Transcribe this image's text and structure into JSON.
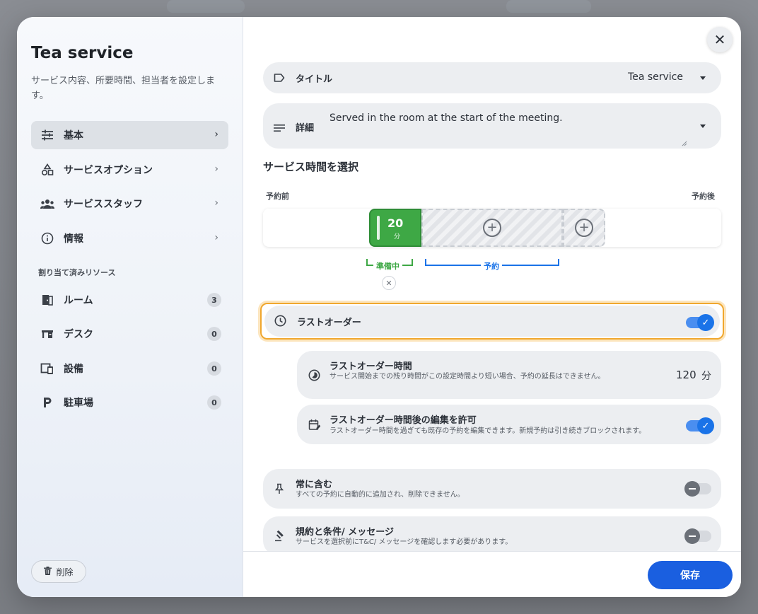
{
  "sidebar": {
    "title": "Tea service",
    "subtitle": "サービス内容、所要時間、担当者を設定します。",
    "nav": [
      {
        "label": "基本",
        "icon": "sliders-icon"
      },
      {
        "label": "サービスオプション",
        "icon": "shapes-icon"
      },
      {
        "label": "サービススタッフ",
        "icon": "group-icon"
      },
      {
        "label": "情報",
        "icon": "info-icon"
      }
    ],
    "resources_heading": "割り当て済みリソース",
    "resources": [
      {
        "label": "ルーム",
        "count": "3",
        "icon": "door-icon"
      },
      {
        "label": "デスク",
        "count": "0",
        "icon": "desk-icon"
      },
      {
        "label": "設備",
        "count": "0",
        "icon": "devices-icon"
      },
      {
        "label": "駐車場",
        "count": "0",
        "icon": "parking-icon"
      }
    ],
    "delete_label": "削除"
  },
  "main": {
    "close_glyph": "✕",
    "title_field": {
      "label": "タイトル",
      "value": "Tea service"
    },
    "detail_field": {
      "label": "詳細",
      "value": "Served in the room at the start of the meeting."
    },
    "service_time_heading": "サービス時間を選択",
    "timeline": {
      "before_label": "予約前",
      "after_label": "予約後",
      "prep_value": "20",
      "prep_unit": "分",
      "prep_bracket_label": "準備中",
      "booking_bracket_label": "予約",
      "remove_glyph": "✕",
      "add_glyph": "+"
    },
    "last_order": {
      "label": "ラストオーダー",
      "enabled": true
    },
    "last_order_time": {
      "title": "ラストオーダー時間",
      "desc": "サービス開始までの残り時間がこの設定時間より短い場合、予約の延長はできません。",
      "value": "120",
      "unit": "分"
    },
    "allow_edit": {
      "title": "ラストオーダー時間後の編集を許可",
      "desc": "ラストオーダー時間を過ぎても既存の予約を編集できます。新規予約は引き続きブロックされます。",
      "enabled": true
    },
    "always_include": {
      "title": "常に含む",
      "desc": "すべての予約に自動的に追加され、削除できません。",
      "enabled": false
    },
    "terms": {
      "title": "規約と条件/ メッセージ",
      "desc": "サービスを選択前にT&C/ メッセージを確認します必要があります。",
      "enabled": false
    },
    "save_label": "保存"
  },
  "colors": {
    "accent": "#1a5fe0",
    "prep": "#3ea845",
    "booking": "#1a73e8",
    "highlight": "#f0a72e"
  }
}
